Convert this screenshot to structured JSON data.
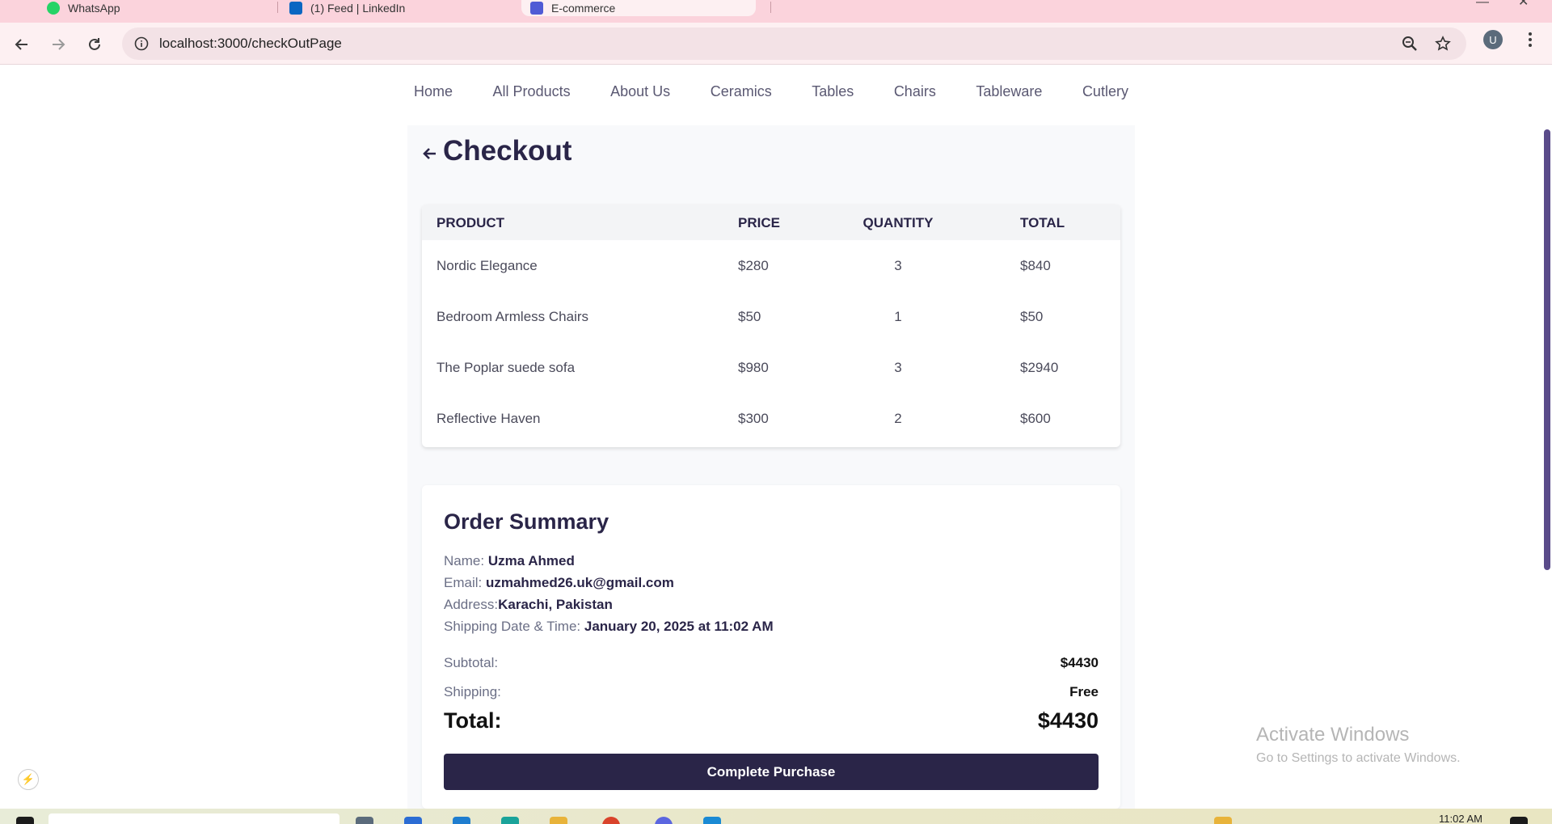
{
  "browser": {
    "tabs": [
      {
        "label": "WhatsApp",
        "favicon_color": "#25d366"
      },
      {
        "label": "(1) Feed | LinkedIn",
        "favicon_color": "#0a66c2"
      },
      {
        "label": "E-commerce",
        "favicon_color": "#4f5bd5",
        "active": true
      }
    ],
    "url": "localhost:3000/checkOutPage",
    "profile_initial": "U",
    "icons": [
      "back-arrow-icon",
      "forward-arrow-icon",
      "reload-icon",
      "site-info-icon",
      "zoom-icon",
      "bookmark-star-icon",
      "kebab-menu-icon"
    ]
  },
  "nav": {
    "items": [
      "Home",
      "All Products",
      "About Us",
      "Ceramics",
      "Tables",
      "Chairs",
      "Tableware",
      "Cutlery"
    ]
  },
  "checkout": {
    "title": "Checkout",
    "columns": {
      "product": "PRODUCT",
      "price": "PRICE",
      "quantity": "QUANTITY",
      "total": "TOTAL"
    },
    "items": [
      {
        "product": "Nordic Elegance",
        "price": "$280",
        "quantity": "3",
        "total": "$840"
      },
      {
        "product": "Bedroom Armless Chairs",
        "price": "$50",
        "quantity": "1",
        "total": "$50"
      },
      {
        "product": "The Poplar suede sofa",
        "price": "$980",
        "quantity": "3",
        "total": "$2940"
      },
      {
        "product": "Reflective Haven",
        "price": "$300",
        "quantity": "2",
        "total": "$600"
      }
    ]
  },
  "summary": {
    "title": "Order Summary",
    "name_label": "Name:",
    "name": "Uzma Ahmed",
    "email_label": "Email:",
    "email": "uzmahmed26.uk@gmail.com",
    "address_label": "Address:",
    "address": "Karachi, Pakistan",
    "shipping_date_label": "Shipping Date & Time:",
    "shipping_date": "January 20, 2025 at 11:02 AM",
    "subtotal_label": "Subtotal:",
    "subtotal": "$4430",
    "shipping_label": "Shipping:",
    "shipping": "Free",
    "total_label": "Total:",
    "total": "$4430",
    "button": "Complete Purchase"
  },
  "watermark": {
    "line1": "Activate Windows",
    "line2": "Go to Settings to activate Windows."
  },
  "taskbar": {
    "time": "11:02 AM"
  },
  "colors": {
    "brand_dark": "#2a2548",
    "chrome_pink": "#fbd3dc",
    "scroll_thumb": "#5a4b8a"
  }
}
